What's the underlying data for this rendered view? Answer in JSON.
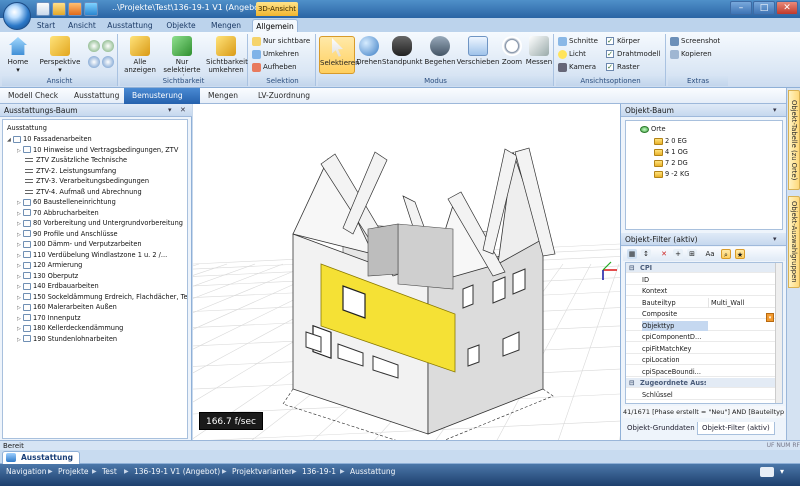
{
  "titlebar": {
    "title": "..\\Projekte\\Test\\136-19-1 V1 (Angebot)",
    "context_tab": "3D-Ansicht",
    "minimize": "–",
    "maximize": "□",
    "close": "✕"
  },
  "ribbon_tabs": [
    "Start",
    "Ansicht",
    "Ausstattung",
    "Objekte",
    "Mengen",
    "Allgemein"
  ],
  "ribbon": {
    "ansicht": {
      "label": "Ansicht",
      "home": "Home",
      "perspektive": "Perspektive"
    },
    "sichtbarkeit": {
      "label": "Sichtbarkeit",
      "alle": "Alle anzeigen",
      "nur_selektierte": "Nur selektierte anzeigen",
      "umkehren": "Sichtbarkeit umkehren"
    },
    "selektion": {
      "label": "Selektion",
      "nur_sichtbare": "Nur sichtbare",
      "umkehren": "Umkehren",
      "aufheben": "Aufheben"
    },
    "modus": {
      "label": "Modus",
      "selektieren": "Selektieren",
      "drehen": "Drehen",
      "standpunkt": "Standpunkt",
      "begehen": "Begehen",
      "verschieben": "Verschieben",
      "zoom": "Zoom",
      "messen": "Messen"
    },
    "ansichtsoptionen": {
      "label": "Ansichtsoptionen",
      "schnitte": "Schnitte",
      "licht": "Licht",
      "kamera": "Kamera",
      "koerper": "Körper",
      "drahtmodell": "Drahtmodell",
      "raster": "Raster"
    },
    "extras": {
      "label": "Extras",
      "screenshot": "Screenshot",
      "kopieren": "Kopieren"
    }
  },
  "workflow": [
    "Modell Check",
    "Ausstattung",
    "Bemusterung",
    "Mengen",
    "LV-Zuordnung"
  ],
  "left_panel": {
    "title": "Ausstattungs-Baum",
    "root": "Ausstattung",
    "items": [
      "10 Fassadenarbeiten",
      "10 Hinweise und Vertragsbedingungen, ZTV",
      "ZTV Zusätzliche Technische",
      "ZTV-2. Leistungsumfang",
      "ZTV-3. Verarbeitungsbedingungen",
      "ZTV-4. Aufmaß und Abrechnung",
      "60 Baustelleneinrichtung",
      "70 Abbrucharbeiten",
      "80 Vorbereitung und Untergrundvorbereitung",
      "90 Profile und Anschlüsse",
      "100 Dämm- und Verputzarbeiten",
      "110 Verdübelung Windlastzone 1 u. 2 /...",
      "120 Armierung",
      "130 Oberputz",
      "140 Erdbauarbeiten",
      "150 Sockeldämmung Erdreich, Flachdächer, Terra",
      "160 Malerarbeiten Außen",
      "170 Innenputz",
      "180 Kellerdeckendämmung",
      "190 Stundenlohnarbeiten"
    ]
  },
  "viewport": {
    "fps": "166.7 f/sec",
    "accent": "#f5e135"
  },
  "object_tree": {
    "title": "Objekt-Baum",
    "root": "Orte",
    "items": [
      "2 0 EG",
      "4 1 OG",
      "7 2 DG",
      "9 -2 KG"
    ]
  },
  "object_filter": {
    "title": "Objekt-Filter (aktiv)",
    "toolbar_text": "Aa",
    "rows": [
      {
        "type": "cat",
        "key": "CPI"
      },
      {
        "key": "ID",
        "value": ""
      },
      {
        "key": "Kontext",
        "value": ""
      },
      {
        "key": "Bauteiltyp",
        "value": "Multi_Wall"
      },
      {
        "key": "Composite",
        "value": ""
      },
      {
        "key": "Objekttyp",
        "value": "",
        "selected": true
      },
      {
        "key": "cpiComponentD...",
        "value": ""
      },
      {
        "key": "cpiFitMatchKey",
        "value": ""
      },
      {
        "key": "cpiLocation",
        "value": ""
      },
      {
        "key": "cpiSpaceBoundi...",
        "value": ""
      },
      {
        "type": "cat",
        "key": "Zugeordnete Ausstattungen"
      },
      {
        "key": "Schlüssel",
        "value": ""
      }
    ],
    "status": "41/1671  [Phase erstellt = \"Neu\"] AND [Bauteiltyp = 'Multi_W",
    "bottom_tabs": [
      "Objekt-Grunddaten",
      "Objekt-Filter (aktiv)"
    ]
  },
  "side_tabs": [
    "Objekt-Tabelle (zu Orte)",
    "Objekt-Auswahlgruppen"
  ],
  "status": {
    "ready": "Bereit",
    "indicators": "UF  NUM  RF"
  },
  "doc_tab": "Ausstattung",
  "navigation": [
    "Navigation",
    "Projekte",
    "Test",
    "136-19-1 V1 (Angebot)",
    "Projektvarianten",
    "136-19-1",
    "Ausstattung"
  ]
}
